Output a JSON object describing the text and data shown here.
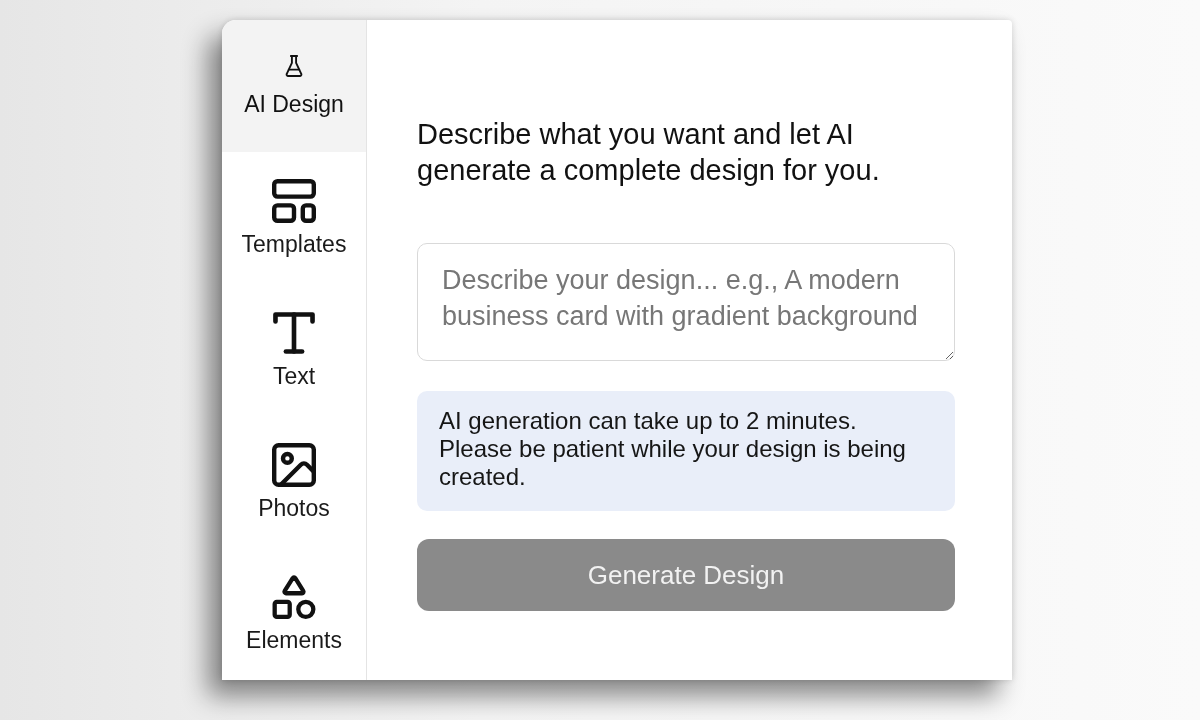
{
  "sidebar": {
    "items": [
      {
        "label": "AI Design",
        "selected": true
      },
      {
        "label": "Templates",
        "selected": false
      },
      {
        "label": "Text",
        "selected": false
      },
      {
        "label": "Photos",
        "selected": false
      },
      {
        "label": "Elements",
        "selected": false
      }
    ]
  },
  "panel": {
    "description": "Describe what you want and let AI generate a complete design for you.",
    "prompt": {
      "placeholder": "Describe your design... e.g., A modern business card with gradient background"
    },
    "notice": "AI generation can take up to 2 minutes. Please be patient while your design is being created.",
    "generate_button": {
      "label": "Generate Design",
      "disabled": true
    }
  }
}
